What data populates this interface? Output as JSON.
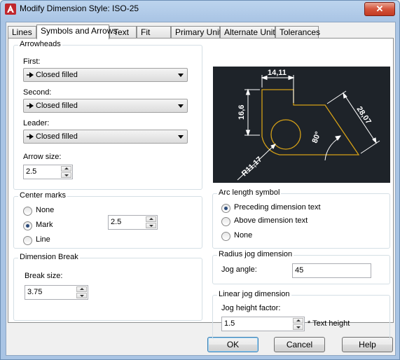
{
  "window": {
    "title": "Modify Dimension Style: ISO-25",
    "close_label": "✕"
  },
  "tabs": [
    "Lines",
    "Symbols and Arrows",
    "Text",
    "Fit",
    "Primary Units",
    "Alternate Units",
    "Tolerances"
  ],
  "arrowheads": {
    "title": "Arrowheads",
    "first_label": "First:",
    "first_value": "Closed filled",
    "second_label": "Second:",
    "second_value": "Closed filled",
    "leader_label": "Leader:",
    "leader_value": "Closed filled",
    "size_label": "Arrow size:",
    "size_value": "2.5"
  },
  "center_marks": {
    "title": "Center marks",
    "options": [
      "None",
      "Mark",
      "Line"
    ],
    "selected": "Mark",
    "size_value": "2.5"
  },
  "dimension_break": {
    "title": "Dimension Break",
    "label": "Break size:",
    "value": "3.75"
  },
  "preview": {
    "top_dim": "14,11",
    "left_dim": "16,6",
    "right_dim": "28,07",
    "angle_dim": "80°",
    "radius_dim": "R11,17"
  },
  "arc_length": {
    "title": "Arc length symbol",
    "options": [
      "Preceding dimension text",
      "Above dimension text",
      "None"
    ],
    "selected": "Preceding dimension text"
  },
  "radius_jog": {
    "title": "Radius jog dimension",
    "label": "Jog angle:",
    "value": "45"
  },
  "linear_jog": {
    "title": "Linear jog dimension",
    "label": "Jog height factor:",
    "value": "1.5",
    "suffix": "* Text height"
  },
  "buttons": {
    "ok": "OK",
    "cancel": "Cancel",
    "help": "Help"
  },
  "colors": {
    "preview_bg": "#1e2329",
    "preview_dim": "#ffffff",
    "preview_geometry": "#d4a017"
  }
}
